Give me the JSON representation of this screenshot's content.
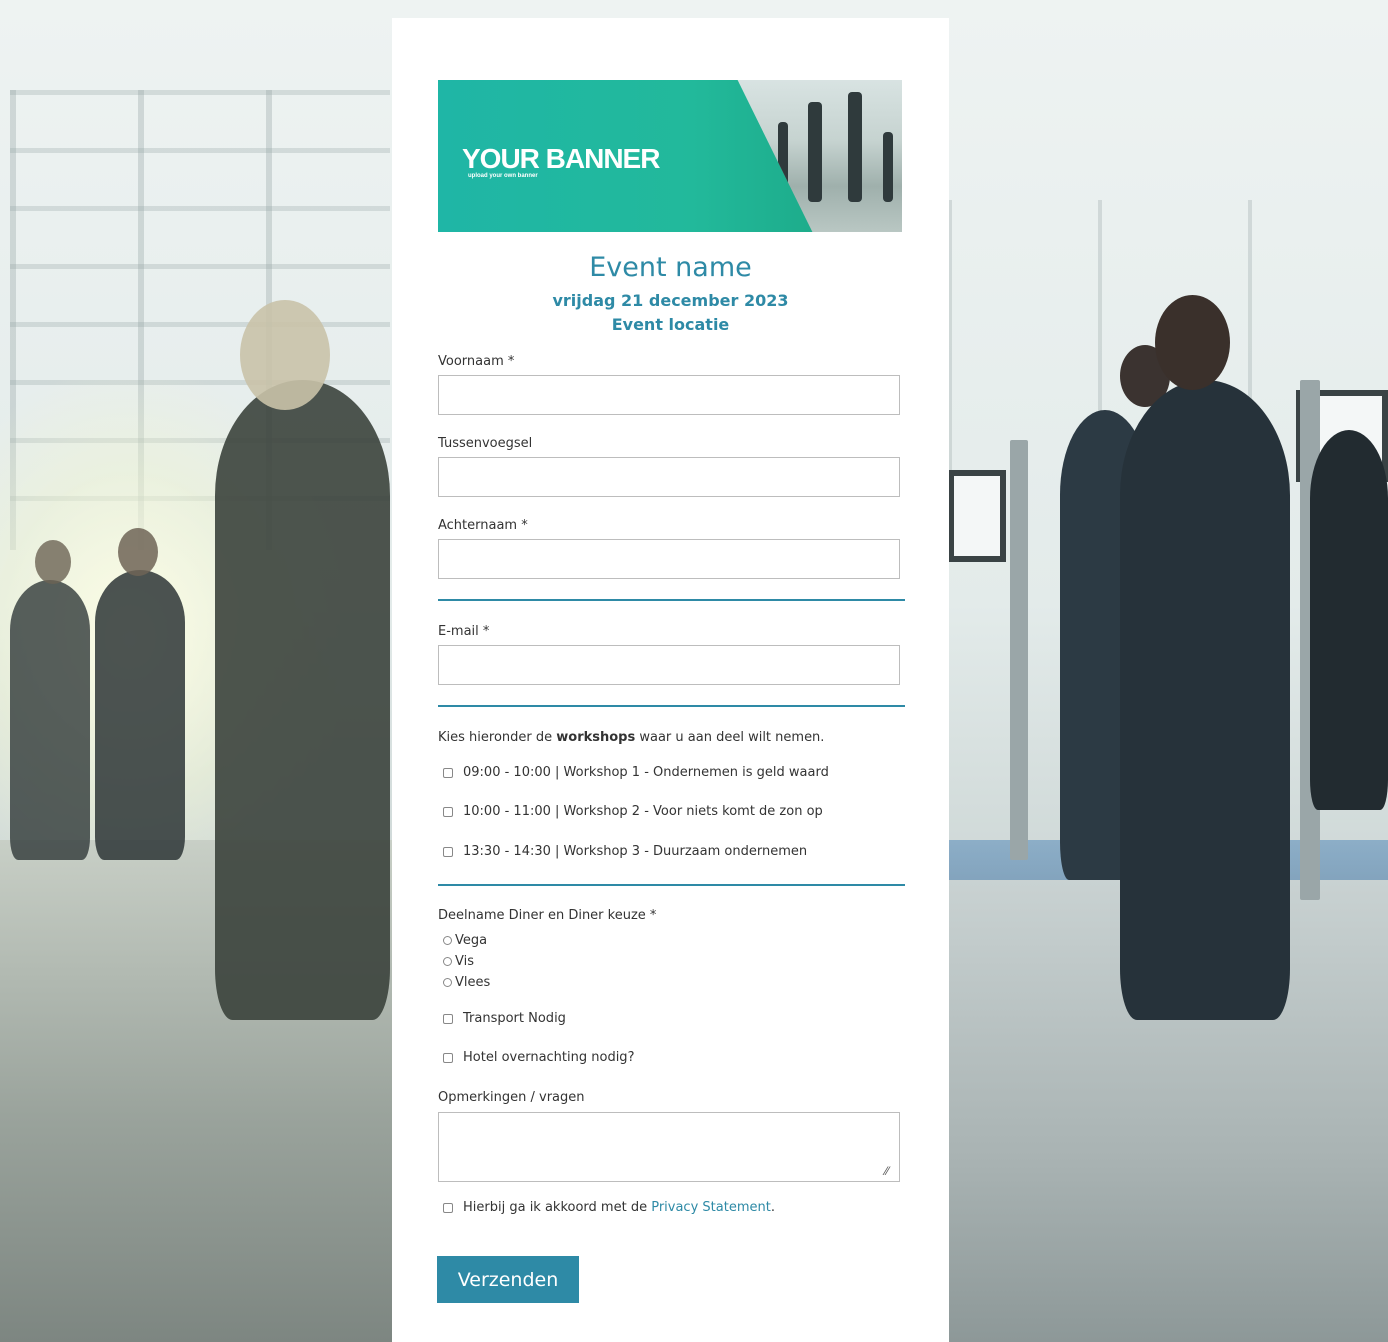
{
  "banner": {
    "title": "YOUR BANNER",
    "subtitle": "upload your own banner"
  },
  "event": {
    "name": "Event name",
    "date": "vrijdag 21 december 2023",
    "location": "Event locatie"
  },
  "form": {
    "voornaam_label": "Voornaam *",
    "voornaam_value": "",
    "tussenvoegsel_label": "Tussenvoegsel",
    "tussenvoegsel_value": "",
    "achternaam_label": "Achternaam *",
    "achternaam_value": "",
    "email_label": "E-mail *",
    "email_value": "",
    "workshops_intro_before": "Kies hieronder de ",
    "workshops_intro_bold": "workshops",
    "workshops_intro_after": " waar u aan deel wilt nemen.",
    "workshops": [
      "09:00 - 10:00 | Workshop 1 - Ondernemen is geld waard",
      "10:00 - 11:00 | Workshop 2 - Voor niets komt de zon op",
      "13:30 - 14:30 | Workshop 3 - Duurzaam ondernemen"
    ],
    "diner_label": "Deelname Diner en Diner keuze *",
    "diner_options": [
      "Vega",
      "Vis",
      "Vlees"
    ],
    "transport_label": "Transport Nodig",
    "hotel_label": "Hotel overnachting nodig?",
    "opmerkingen_label": "Opmerkingen / vragen",
    "opmerkingen_value": "",
    "privacy_before": "Hierbij ga ik akkoord met de ",
    "privacy_link": "Privacy Statement",
    "privacy_after": ".",
    "submit_label": "Verzenden"
  },
  "colors": {
    "accent": "#2e8aa6",
    "banner_green": "#1fb6a6"
  }
}
